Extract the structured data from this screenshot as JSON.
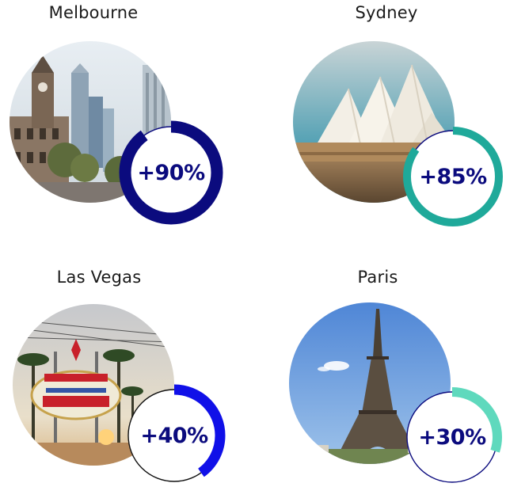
{
  "cities": [
    {
      "name": "Melbourne",
      "growth": "+90%",
      "growth_value": 90,
      "ring_color": "#0b0b7e",
      "track_color": "#0b0b7e"
    },
    {
      "name": "Sydney",
      "growth": "+85%",
      "growth_value": 85,
      "ring_color": "#1fa99a",
      "track_color": "#0b0b7e"
    },
    {
      "name": "Las Vegas",
      "growth": "+40%",
      "growth_value": 40,
      "ring_color": "#1010e8",
      "track_color": "#111111"
    },
    {
      "name": "Paris",
      "growth": "+30%",
      "growth_value": 30,
      "ring_color": "#5fd9bd",
      "track_color": "#0b0b7e"
    }
  ]
}
